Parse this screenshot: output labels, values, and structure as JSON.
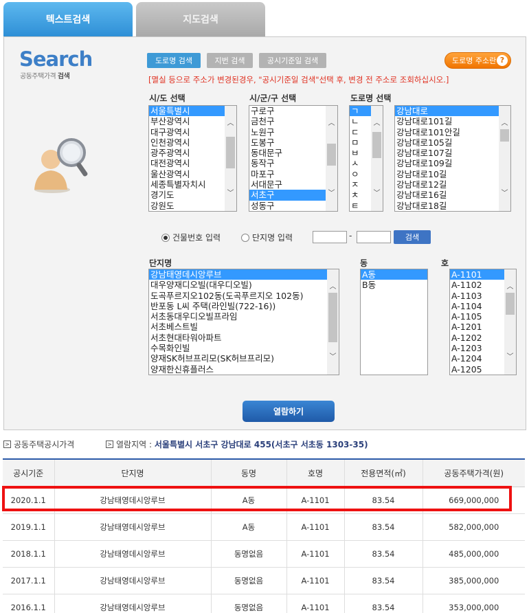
{
  "tabs": [
    "텍스트검색",
    "지도검색"
  ],
  "logo": {
    "title": "Search",
    "subtitle_prefix": "공동주택가격",
    "subtitle_bold": "검색"
  },
  "mode_buttons": [
    "도로명 검색",
    "지번 검색",
    "공시기준일 검색"
  ],
  "guide_button": "도로명 주소란",
  "notice": "[멸실 등으로 주소가 변경된경우, \"공시기준일 검색\"선택 후, 변경 전 주소로 조회하십시오.]",
  "labels": {
    "sido": "시/도 선택",
    "sigungu": "시/군/구 선택",
    "road": "도로명 선택",
    "complex": "단지명",
    "dong": "동",
    "ho": "호"
  },
  "sido": [
    "서울특별시",
    "부산광역시",
    "대구광역시",
    "인천광역시",
    "광주광역시",
    "대전광역시",
    "울산광역시",
    "세종특별자치시",
    "경기도",
    "강원도"
  ],
  "sigungu": [
    "구로구",
    "금천구",
    "노원구",
    "도봉구",
    "동대문구",
    "동작구",
    "마포구",
    "서대문구",
    "서초구",
    "성동구"
  ],
  "initials": [
    "ㄱ",
    "ㄴ",
    "ㄷ",
    "ㅁ",
    "ㅂ",
    "ㅅ",
    "ㅇ",
    "ㅈ",
    "ㅊ",
    "ㅌ"
  ],
  "roads": [
    "강남대로",
    "강남대로101길",
    "강남대로101안길",
    "강남대로105길",
    "강남대로107길",
    "강남대로109길",
    "강남대로10길",
    "강남대로12길",
    "강남대로16길",
    "강남대로18길"
  ],
  "radio": {
    "building": "건물번호 입력",
    "complex": "단지명 입력"
  },
  "search_button": "검색",
  "complexes": [
    "강남태영데시앙루브",
    "대우양재디오빌(대우디오빌)",
    "도곡푸르지오102동(도곡푸르지오 102동)",
    "반포동 L씨 주택(라인빌(722-16))",
    "서초동대우디오빌프라임",
    "서초베스트빌",
    "서초현대타워아파트",
    "수목화인빌",
    "양재SK허브프리모(SK허브프리모)",
    "양재한신휴플러스"
  ],
  "dongs": [
    "A동",
    "B동"
  ],
  "hos": [
    "A-1101",
    "A-1102",
    "A-1103",
    "A-1104",
    "A-1105",
    "A-1201",
    "A-1202",
    "A-1203",
    "A-1204",
    "A-1205"
  ],
  "open_button": "열람하기",
  "info": {
    "price_label": "공동주택공시가격",
    "region_label": "열람지역 :",
    "region_value": "서울특별시 서초구 강남대로 455(서초구 서초동 1303-35)"
  },
  "table": {
    "headers": [
      "공시기준",
      "단지명",
      "동명",
      "호명",
      "전용면적(㎡)",
      "공동주택가격(원)"
    ],
    "rows": [
      [
        "2020.1.1",
        "강남태영데시앙루브",
        "A동",
        "A-1101",
        "83.54",
        "669,000,000"
      ],
      [
        "2019.1.1",
        "강남태영데시앙루브",
        "A동",
        "A-1101",
        "83.54",
        "582,000,000"
      ],
      [
        "2018.1.1",
        "강남태영데시앙루브",
        "동명없음",
        "A-1101",
        "83.54",
        "485,000,000"
      ],
      [
        "2017.1.1",
        "강남태영데시앙루브",
        "동명없음",
        "A-1101",
        "83.54",
        "385,000,000"
      ],
      [
        "2016.1.1",
        "강남태영데시앙루브",
        "동명없음",
        "A-1101",
        "83.54",
        "353,000,000"
      ]
    ]
  }
}
